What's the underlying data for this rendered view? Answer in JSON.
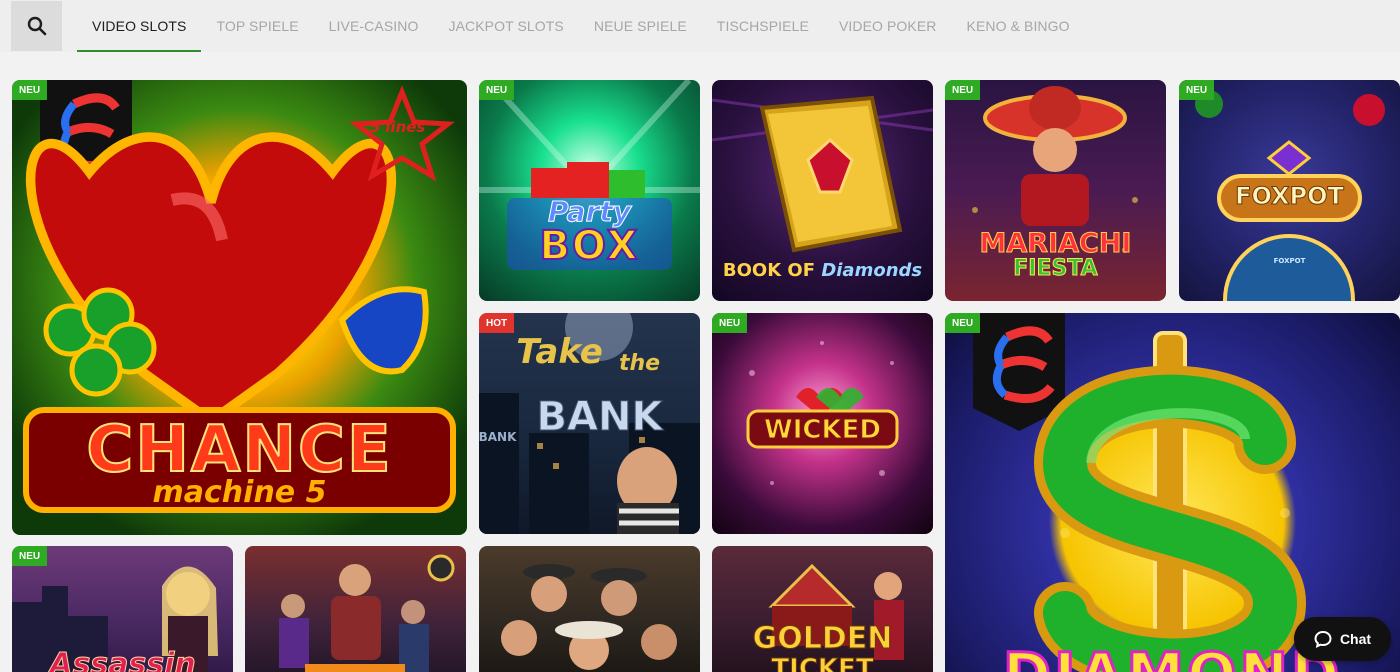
{
  "header": {
    "search_icon": "search-icon",
    "tabs": [
      {
        "label": "VIDEO SLOTS",
        "active": true
      },
      {
        "label": "TOP SPIELE",
        "active": false
      },
      {
        "label": "LIVE-CASINO",
        "active": false
      },
      {
        "label": "JACKPOT SLOTS",
        "active": false
      },
      {
        "label": "NEUE SPIELE",
        "active": false
      },
      {
        "label": "TISCHSPIELE",
        "active": false
      },
      {
        "label": "VIDEO POKER",
        "active": false
      },
      {
        "label": "KENO & BINGO",
        "active": false
      }
    ],
    "active_color": "#2f8f2f"
  },
  "games": {
    "chance_machine": {
      "badge": "NEU",
      "line1": "CHANCE",
      "line2": "machine 5",
      "star_text": "5 lines"
    },
    "party_box": {
      "badge": "NEU",
      "line1": "Party",
      "line2": "BOX"
    },
    "book_of_diamonds": {
      "line1": "BOOK OF",
      "line2": "Diamonds"
    },
    "mariachi_fiesta": {
      "badge": "NEU",
      "line1": "MARIACHI",
      "line2": "FIESTA"
    },
    "foxpot": {
      "badge": "NEU",
      "line1": "FOXPOT",
      "wheel_label": "FOXPOT"
    },
    "take_the_bank": {
      "badge": "HOT",
      "line1": "Take",
      "line2": "the",
      "line3": "BANK",
      "sign_text": "BANK"
    },
    "wicked": {
      "badge": "NEU",
      "line1": "WICKED"
    },
    "diamond": {
      "badge": "NEU",
      "line1": "DIAMOND"
    },
    "assassin": {
      "badge": "NEU",
      "line1": "Assassin"
    },
    "heroes": {
      "line1": ""
    },
    "mafia": {
      "line1": ""
    },
    "golden_ticket": {
      "line1": "GOLDEN",
      "line2": "TICKET"
    }
  },
  "badge_colors": {
    "neu": "#2eaa23",
    "hot": "#e0352d"
  },
  "chat": {
    "label": "Chat",
    "icon": "chat-bubble-icon"
  }
}
